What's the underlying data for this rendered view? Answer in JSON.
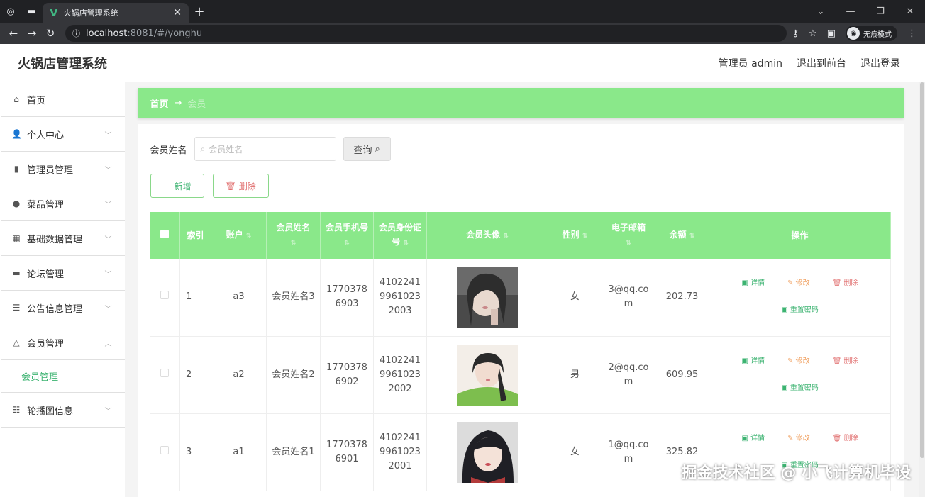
{
  "browser": {
    "tab_title": "火锅店管理系统",
    "host": "localhost",
    "path": ":8081/#/yonghu",
    "incognito_label": "无痕模式"
  },
  "header": {
    "app_title": "火锅店管理系统",
    "user_label": "管理员 admin",
    "frontend_label": "退出到前台",
    "logout_label": "退出登录"
  },
  "sidebar": {
    "items": [
      {
        "label": "首页",
        "icon": "home-icon"
      },
      {
        "label": "个人中心",
        "icon": "user-icon"
      },
      {
        "label": "管理员管理",
        "icon": "bar-chart-icon"
      },
      {
        "label": "菜品管理",
        "icon": "location-icon"
      },
      {
        "label": "基础数据管理",
        "icon": "grid-icon"
      },
      {
        "label": "论坛管理",
        "icon": "forum-icon"
      },
      {
        "label": "公告信息管理",
        "icon": "sliders-icon"
      },
      {
        "label": "会员管理",
        "icon": "bell-icon"
      },
      {
        "label": "轮播图信息",
        "icon": "list-icon"
      }
    ],
    "sub_item": "会员管理"
  },
  "breadcrumb": {
    "home": "首页",
    "arrow": "→",
    "current": "会员"
  },
  "search": {
    "label": "会员姓名",
    "placeholder": "会员姓名",
    "button": "查询"
  },
  "actions": {
    "add": "新增",
    "delete": "删除"
  },
  "table": {
    "headers": [
      "索引",
      "账户",
      "会员姓名",
      "会员手机号",
      "会员身份证号",
      "会员头像",
      "性别",
      "电子邮箱",
      "余额",
      "操作"
    ],
    "rows": [
      {
        "index": "1",
        "account": "a3",
        "name": "会员姓名3",
        "phone": "17703786903",
        "id_card": "410224199610232003",
        "gender": "女",
        "email": "3@qq.com",
        "balance": "202.73"
      },
      {
        "index": "2",
        "account": "a2",
        "name": "会员姓名2",
        "phone": "17703786902",
        "id_card": "410224199610232002",
        "gender": "男",
        "email": "2@qq.com",
        "balance": "609.95"
      },
      {
        "index": "3",
        "account": "a1",
        "name": "会员姓名1",
        "phone": "17703786901",
        "id_card": "410224199610232001",
        "gender": "女",
        "email": "1@qq.com",
        "balance": "325.82"
      }
    ],
    "op_labels": {
      "detail": "详情",
      "edit": "修改",
      "delete": "删除",
      "reset": "重置密码"
    }
  },
  "watermark": "掘金技术社区 @ 小飞计算机毕设"
}
